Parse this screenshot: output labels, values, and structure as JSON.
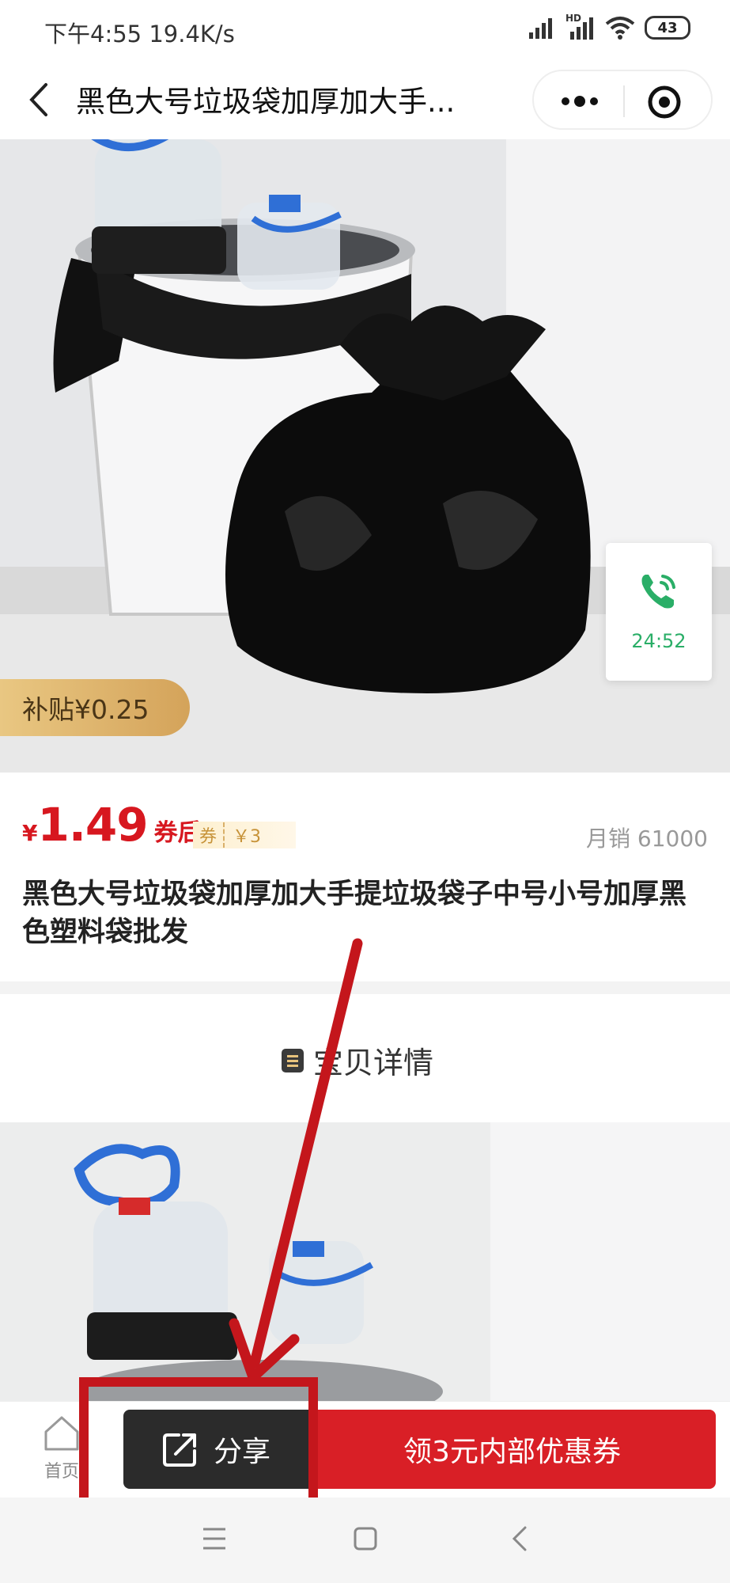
{
  "status_bar": {
    "time_speed": "下午4:55 19.4K/s",
    "hd_label": "HD",
    "battery": "43"
  },
  "header": {
    "title": "黑色大号垃圾袋加厚加大手...",
    "back_icon": "chevron-left-icon",
    "more_icon": "more-dots-icon",
    "close_icon": "target-circle-icon"
  },
  "hero": {
    "subsidy": "补贴¥0.25",
    "call_timer": "24:52"
  },
  "product": {
    "currency": "¥",
    "price": "1.49",
    "price_suffix": "券后",
    "coupon_tag": "券",
    "coupon_value": "￥3",
    "monthly_sales": "月销 61000",
    "title": "黑色大号垃圾袋加厚加大手提垃圾袋子中号小号加厚黑色塑料袋批发"
  },
  "detail": {
    "heading": "宝贝详情"
  },
  "bottom_bar": {
    "home_label": "首页",
    "share_label": "分享",
    "coupon_button": "领3元内部优惠券"
  },
  "colors": {
    "accent_red": "#d91f26",
    "price_red": "#d7171f",
    "share_dark": "#2b2b2b",
    "call_green": "#2aae67",
    "subsidy_gold": "#e9c782"
  }
}
